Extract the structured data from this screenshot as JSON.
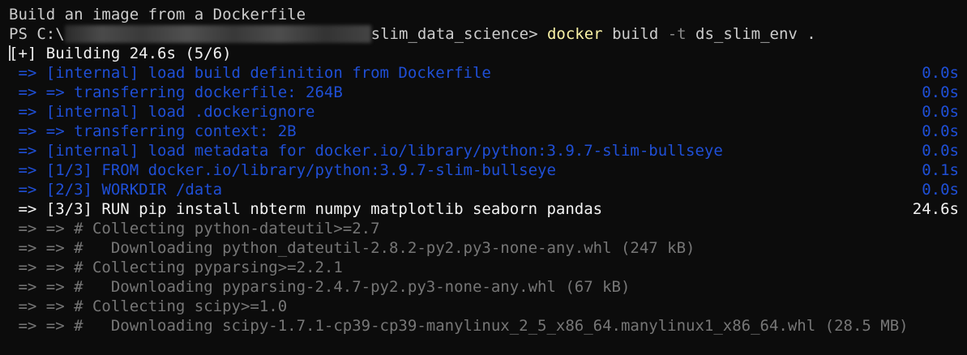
{
  "terminal": {
    "title_line": "Build an image from a Dockerfile",
    "prompt": {
      "prefix": "PS C:\\",
      "path_suffix": "slim_data_science> ",
      "command": "docker",
      "args_1": " build ",
      "flag": "-t",
      "args_2": " ds_slim_env ."
    },
    "building": "[+] Building 24.6s (5/6)",
    "steps": [
      {
        "text": " => [internal] load build definition from Dockerfile",
        "time": "0.0s"
      },
      {
        "text": " => => transferring dockerfile: 264B",
        "time": "0.0s"
      },
      {
        "text": " => [internal] load .dockerignore",
        "time": "0.0s"
      },
      {
        "text": " => => transferring context: 2B",
        "time": "0.0s"
      },
      {
        "text": " => [internal] load metadata for docker.io/library/python:3.9.7-slim-bullseye",
        "time": "0.0s"
      },
      {
        "text": " => [1/3] FROM docker.io/library/python:3.9.7-slim-bullseye",
        "time": "0.1s"
      },
      {
        "text": " => [2/3] WORKDIR /data",
        "time": "0.0s"
      }
    ],
    "active_step": {
      "text": " => [3/3] RUN pip install nbterm numpy matplotlib seaborn pandas",
      "time": "24.6s"
    },
    "log": [
      " => => # Collecting python-dateutil>=2.7",
      " => => #   Downloading python_dateutil-2.8.2-py2.py3-none-any.whl (247 kB)",
      " => => # Collecting pyparsing>=2.2.1",
      " => => #   Downloading pyparsing-2.4.7-py2.py3-none-any.whl (67 kB)",
      " => => # Collecting scipy>=1.0",
      " => => #   Downloading scipy-1.7.1-cp39-cp39-manylinux_2_5_x86_64.manylinux1_x86_64.whl (28.5 MB)"
    ],
    "colors": {
      "background": "#0c0c0c",
      "text": "#cccccc",
      "blue_step": "#1f4fd6",
      "gray_log": "#767676",
      "command_yellow": "#f9f1a5"
    }
  }
}
